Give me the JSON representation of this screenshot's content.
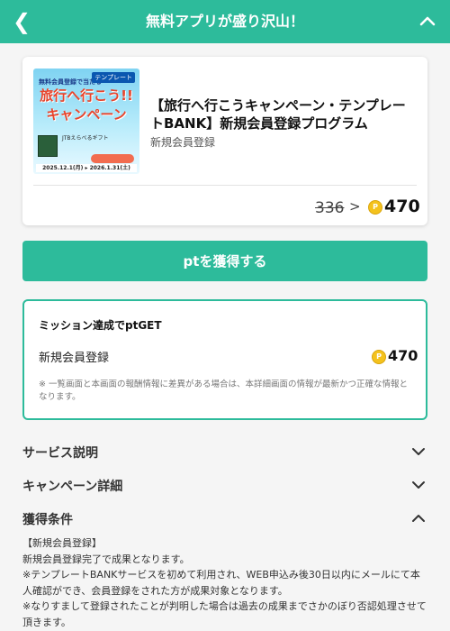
{
  "header": {
    "title": "無料アプリが盛り沢山！"
  },
  "offer": {
    "title": "【旅行へ行こうキャンペーン・テンプレートBANK】新規会員登録プログラム",
    "subtitle": "新規会員登録",
    "old_points": "336",
    "arrow": ">",
    "new_points": "470",
    "coin_symbol": "P",
    "banner": {
      "tag": "無料会員登録で当たる",
      "logo": "テンプレート",
      "headline_1": "旅行へ行こう!!",
      "headline_2": "キャンペーン",
      "gift": "JTBえらべるギフト",
      "dates": "2025.12.1(月) ▸ 2026.1.31(土)"
    }
  },
  "cta": {
    "label": "ptを獲得する"
  },
  "mission": {
    "title": "ミッション達成でptGET",
    "task": "新規会員登録",
    "points": "470",
    "note": "※ 一覧画面と本画面の報酬情報に差異がある場合は、本詳細画面の情報が最新かつ正確な情報となります。"
  },
  "sections": {
    "service": "サービス説明",
    "campaign": "キャンペーン詳細",
    "conditions": "獲得条件"
  },
  "conditions": {
    "heading": "【新規会員登録】",
    "line1": "新規会員登録完了で成果となります。",
    "line2": "※テンプレートBANKサービスを初めて利用され、WEB申込み後30日以内にメールにて本人確認ができ、会員登録をされた方が成果対象となります。",
    "line3": "※なりすまして登録されたことが判明した場合は過去の成果までさかのぼり否認処理させて頂きます。"
  },
  "colors": {
    "brand": "#2dbb9b",
    "coin": "#f4c21d"
  }
}
